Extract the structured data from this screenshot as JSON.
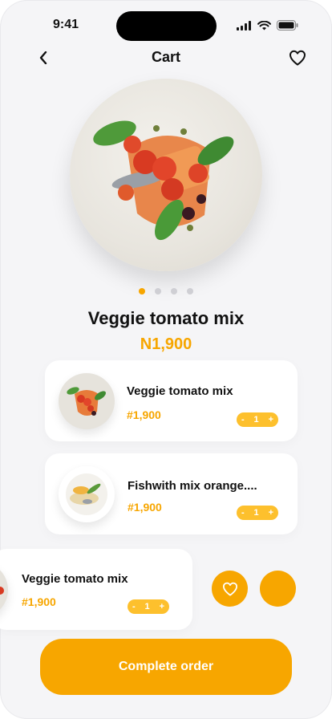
{
  "status_bar": {
    "time": "9:41"
  },
  "header": {
    "title": "Cart",
    "back_icon": "back-arrow-icon",
    "favorite_icon": "heart-outline-icon"
  },
  "carousel": {
    "total": 4,
    "active": 1
  },
  "product": {
    "name": "Veggie tomato mix",
    "price": "N1,900"
  },
  "cart_items": [
    {
      "name": "Veggie tomato mix",
      "price": "#1,900",
      "qty": "1",
      "minus": "-",
      "plus": "+"
    },
    {
      "name": "Fishwith mix orange....",
      "price": "#1,900",
      "qty": "1",
      "minus": "-",
      "plus": "+"
    },
    {
      "name": "Veggie tomato mix",
      "price": "#1,900",
      "qty": "1",
      "minus": "-",
      "plus": "+"
    }
  ],
  "swipe_actions": {
    "favorite_icon": "heart-icon",
    "delete_icon": ""
  },
  "cta": {
    "label": "Complete order"
  },
  "colors": {
    "accent": "#f7a600",
    "stepper": "#fdc02d",
    "background": "#f5f5f7"
  }
}
